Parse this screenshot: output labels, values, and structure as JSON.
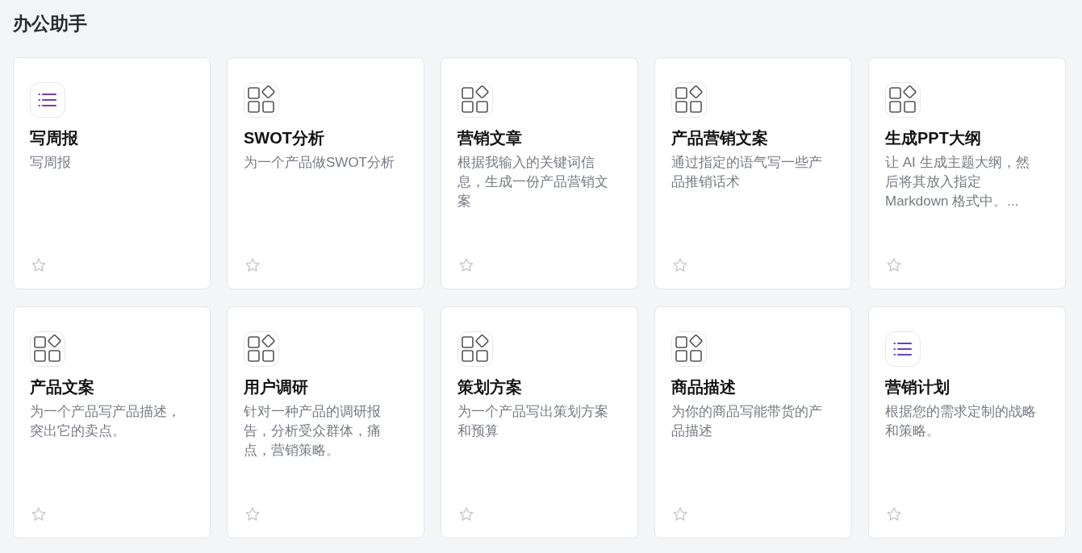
{
  "title": "办公助手",
  "cards": [
    {
      "kind": "list",
      "title": "写周报",
      "description": "写周报",
      "starred": false
    },
    {
      "kind": "grid",
      "title": "SWOT分析",
      "description": "为一个产品做SWOT分析",
      "starred": false
    },
    {
      "kind": "grid",
      "title": "营销文章",
      "description": "根据我输入的关键词信息，生成一份产品营销文案",
      "starred": false
    },
    {
      "kind": "grid",
      "title": "产品营销文案",
      "description": "通过指定的语气写一些产品推销话术",
      "starred": false
    },
    {
      "kind": "grid",
      "title": "生成PPT大纲",
      "description": "让 AI 生成主题大纲，然后将其放入指定 Markdown 格式中。...",
      "starred": false
    },
    {
      "kind": "grid",
      "title": "产品文案",
      "description": "为一个产品写产品描述，突出它的卖点。",
      "starred": false
    },
    {
      "kind": "grid",
      "title": "用户调研",
      "description": "针对一种产品的调研报告，分析受众群体，痛点，营销策略。",
      "starred": false
    },
    {
      "kind": "grid",
      "title": "策划方案",
      "description": "为一个产品写出策划方案和预算",
      "starred": false
    },
    {
      "kind": "grid",
      "title": "商品描述",
      "description": "为你的商品写能带货的产品描述",
      "starred": false
    },
    {
      "kind": "list",
      "title": "营销计划",
      "description": "根据您的需求定制的战略和策略。",
      "starred": false
    }
  ]
}
